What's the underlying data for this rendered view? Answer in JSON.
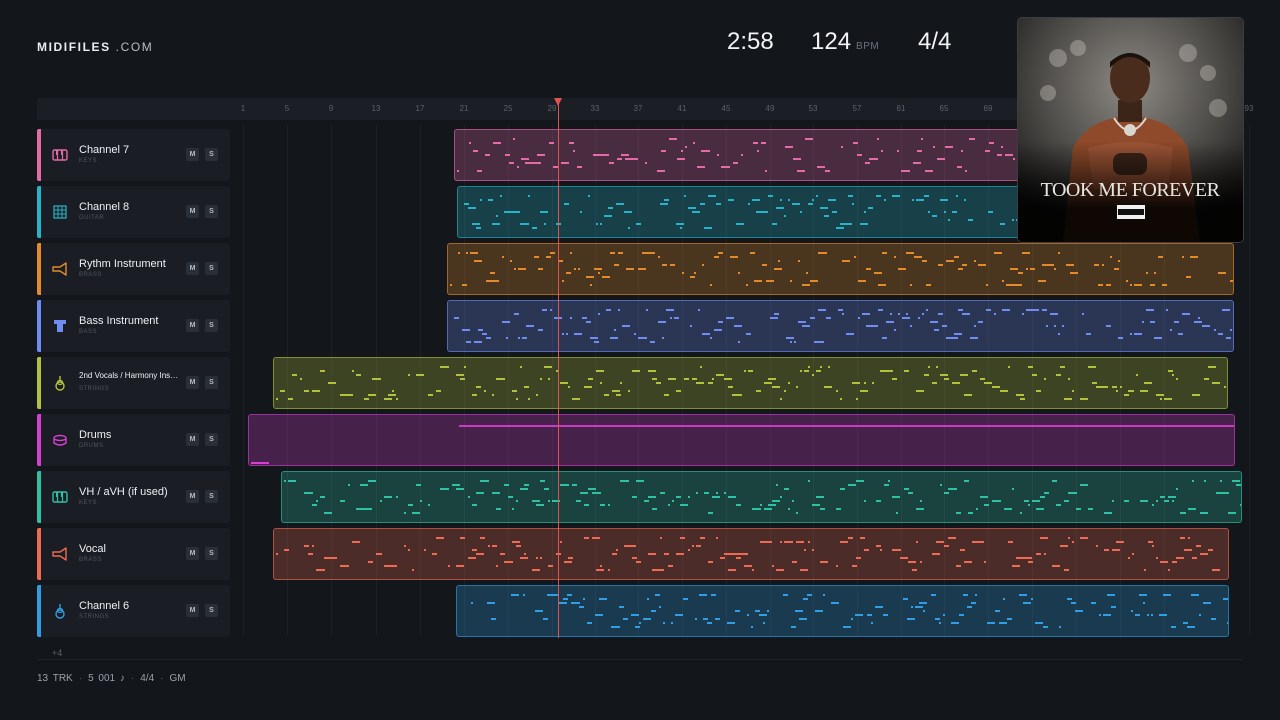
{
  "brand": {
    "name": "MIDIFILES",
    "tld": ".COM"
  },
  "stats": {
    "time": "2:58",
    "tempo": "124",
    "tempo_unit": "BPM",
    "signature": "4/4"
  },
  "ruler": {
    "ticks": [
      "1",
      "5",
      "9",
      "13",
      "17",
      "21",
      "25",
      "29",
      "33",
      "37",
      "41",
      "45",
      "49",
      "53",
      "57",
      "61",
      "65",
      "69",
      "",
      "",
      "",
      "",
      "93"
    ]
  },
  "tracks": [
    {
      "name": "Channel 7",
      "type": "KEYS",
      "color": "#e46aa8",
      "icon": "piano-keys-icon"
    },
    {
      "name": "Channel 8",
      "type": "GUITAR",
      "color": "#27b3c9",
      "icon": "guitar-grid-icon"
    },
    {
      "name": "Rythm Instrument",
      "type": "BRASS",
      "color": "#e48a2a",
      "icon": "trumpet-icon"
    },
    {
      "name": "Bass Instrument",
      "type": "BASS",
      "color": "#6f8cf2",
      "icon": "bass-icon"
    },
    {
      "name": "2nd Vocals / Harmony Ins…",
      "type": "STRINGS",
      "color": "#b2c23c",
      "icon": "violin-icon"
    },
    {
      "name": "Drums",
      "type": "DRUMS",
      "color": "#d63fd0",
      "icon": "drum-icon"
    },
    {
      "name": "VH / aVH (if used)",
      "type": "KEYS",
      "color": "#2fc1a4",
      "icon": "piano-keys-icon"
    },
    {
      "name": "Vocal",
      "type": "BRASS",
      "color": "#ee6a52",
      "icon": "trumpet-icon"
    },
    {
      "name": "Channel 6",
      "type": "STRINGS",
      "color": "#2f9ee4",
      "icon": "violin-icon"
    }
  ],
  "buttons": {
    "mute": "M",
    "solo": "S"
  },
  "more_tracks": "+4",
  "footer": {
    "tracks": "13 TRK",
    "notes": "5 001 ♪",
    "signature": "4/4",
    "standard": "GM"
  },
  "cover": {
    "title": "TOOK ME FOREVER",
    "badge": "PARENTAL ADVISORY EXPLICIT CONTENT"
  },
  "playhead_bar": 29
}
